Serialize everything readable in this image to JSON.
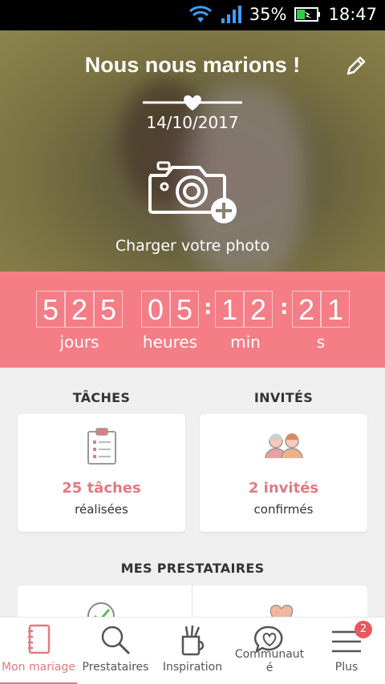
{
  "status_bar": {
    "battery": "35%",
    "time": "18:47"
  },
  "hero": {
    "title": "Nous nous marions !",
    "date": "14/10/2017",
    "upload_label": "Charger votre photo"
  },
  "countdown": {
    "days": [
      "5",
      "2",
      "5"
    ],
    "hours": [
      "0",
      "5"
    ],
    "minutes": [
      "1",
      "2"
    ],
    "seconds": [
      "2",
      "1"
    ],
    "labels": {
      "days": "jours",
      "hours": "heures",
      "minutes": "min",
      "seconds": "s"
    }
  },
  "tasks": {
    "section_title": "TÂCHES",
    "count": "25 tâches",
    "sub": "réalisées"
  },
  "guests": {
    "section_title": "INVITÉS",
    "count": "2 invités",
    "sub": "confirmés"
  },
  "vendors": {
    "section_title": "MES PRESTATAIRES"
  },
  "nav": {
    "items": [
      {
        "label": "Mon mariage",
        "icon": "notebook-icon"
      },
      {
        "label": "Prestataires",
        "icon": "search-icon"
      },
      {
        "label": "Inspiration",
        "icon": "brush-cup-icon"
      },
      {
        "label": "Communaut\né",
        "icon": "heart-chat-icon"
      },
      {
        "label": "Plus",
        "icon": "menu-icon"
      }
    ],
    "badge": "2"
  },
  "colors": {
    "accent": "#f47d86",
    "accent_text": "#e07a80"
  }
}
